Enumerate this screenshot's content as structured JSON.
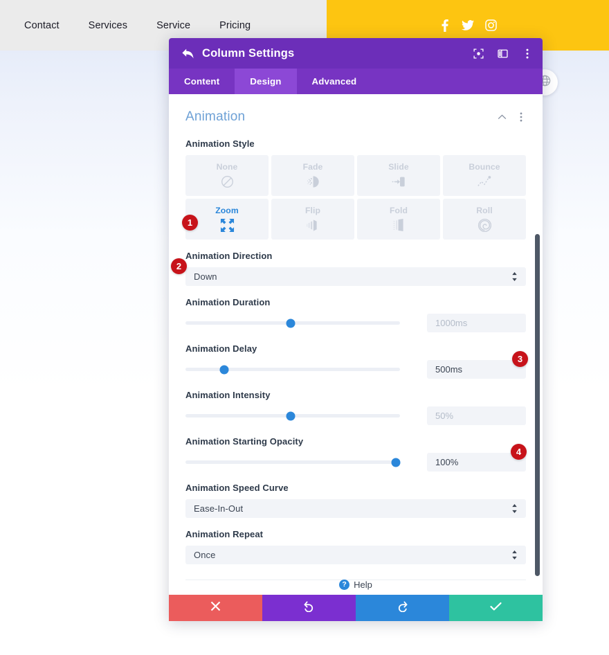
{
  "topnav": {
    "links": [
      "Contact",
      "Services",
      "Service",
      "Pricing"
    ],
    "social": [
      "facebook-icon",
      "twitter-icon",
      "instagram-icon"
    ],
    "bg_left": "#ebebeb",
    "bg_right": "#fdc511"
  },
  "floating": {
    "globe_button": "globe-icon"
  },
  "modal": {
    "title": "Column Settings",
    "back_icon": "back-arrow-icon",
    "header_icons": [
      "focus-target-icon",
      "layout-panel-icon",
      "vertical-dots-icon"
    ],
    "accent": "#6c2eb9",
    "tabs": [
      {
        "label": "Content",
        "active": false
      },
      {
        "label": "Design",
        "active": true
      },
      {
        "label": "Advanced",
        "active": false
      }
    ],
    "section": {
      "title": "Animation",
      "title_color": "#6ea1d6",
      "collapse_icon": "chevron-up-icon",
      "more_icon": "vertical-dots-icon"
    },
    "animation_style": {
      "label": "Animation Style",
      "options": [
        {
          "label": "None",
          "icon": "no-entry-icon",
          "selected": false
        },
        {
          "label": "Fade",
          "icon": "fade-icon",
          "selected": false
        },
        {
          "label": "Slide",
          "icon": "slide-icon",
          "selected": false
        },
        {
          "label": "Bounce",
          "icon": "bounce-icon",
          "selected": false
        },
        {
          "label": "Zoom",
          "icon": "zoom-expand-icon",
          "selected": true
        },
        {
          "label": "Flip",
          "icon": "flip-icon",
          "selected": false
        },
        {
          "label": "Fold",
          "icon": "fold-icon",
          "selected": false
        },
        {
          "label": "Roll",
          "icon": "roll-spiral-icon",
          "selected": false
        }
      ]
    },
    "fields": {
      "direction": {
        "label": "Animation Direction",
        "value": "Down"
      },
      "duration": {
        "label": "Animation Duration",
        "value": "1000ms",
        "is_placeholder": true,
        "slider_percent": 49
      },
      "delay": {
        "label": "Animation Delay",
        "value": "500ms",
        "is_placeholder": false,
        "slider_percent": 18
      },
      "intensity": {
        "label": "Animation Intensity",
        "value": "50%",
        "is_placeholder": true,
        "slider_percent": 49
      },
      "starting_opacity": {
        "label": "Animation Starting Opacity",
        "value": "100%",
        "is_placeholder": false,
        "slider_percent": 98
      },
      "speed_curve": {
        "label": "Animation Speed Curve",
        "value": "Ease-In-Out"
      },
      "repeat": {
        "label": "Animation Repeat",
        "value": "Once"
      }
    },
    "help": {
      "label": "Help",
      "icon": "question-mark-icon"
    },
    "footer": [
      {
        "name": "cancel",
        "icon": "close-x-icon",
        "color": "#eb5c5c"
      },
      {
        "name": "undo",
        "icon": "undo-icon",
        "color": "#7b2fd0"
      },
      {
        "name": "redo",
        "icon": "redo-icon",
        "color": "#2b87da"
      },
      {
        "name": "save",
        "icon": "checkmark-icon",
        "color": "#2ec2a0"
      }
    ]
  },
  "annotations": [
    {
      "number": "1"
    },
    {
      "number": "2"
    },
    {
      "number": "3"
    },
    {
      "number": "4"
    }
  ]
}
